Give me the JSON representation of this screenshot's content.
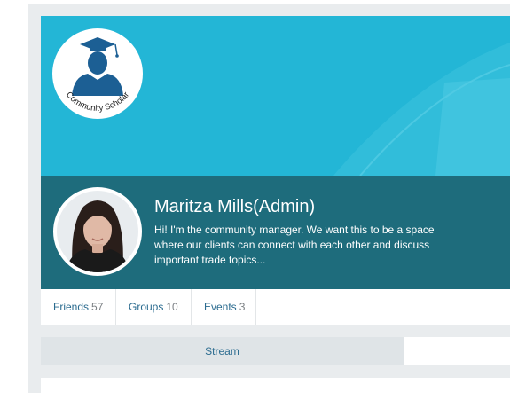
{
  "cover": {
    "logo": {
      "text": "Community Scholar",
      "icon": "graduate-icon"
    }
  },
  "profile": {
    "name": "Maritza Mills(Admin)",
    "bio": "Hi! I'm the community manager. We want this to be a space where our clients can connect with each other and discuss important trade topics..."
  },
  "stats": [
    {
      "label": "Friends",
      "count": "57"
    },
    {
      "label": "Groups",
      "count": "10"
    },
    {
      "label": "Events",
      "count": "3"
    }
  ],
  "tabs": {
    "stream_label": "Stream"
  },
  "colors": {
    "cover": "#23b6d6",
    "profile_band": "#1e6c7c",
    "link": "#2a6b8f",
    "page_background": "#e9ecee"
  }
}
